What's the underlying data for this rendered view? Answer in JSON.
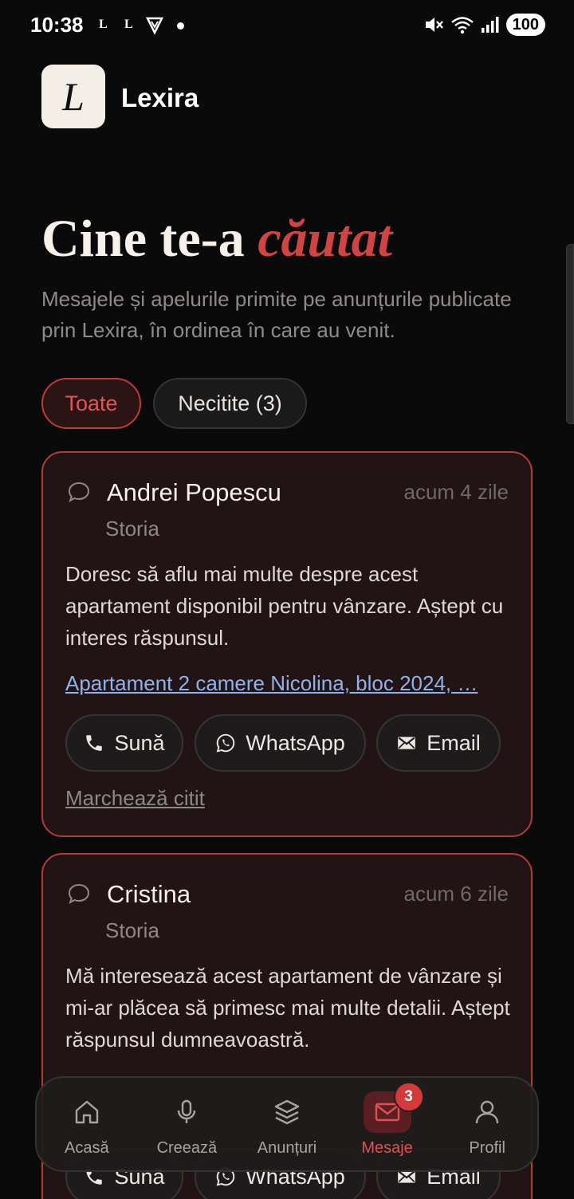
{
  "status_bar": {
    "time": "10:38",
    "notif1": "L",
    "notif2": "L",
    "battery": "100"
  },
  "header": {
    "logo_letter": "L",
    "app_name": "Lexira"
  },
  "page": {
    "title_main": "Cine te-a ",
    "title_accent": "căutat",
    "subtitle": "Mesajele și apelurile primite pe anunțurile publicate prin Lexira, în ordinea în care au venit."
  },
  "filters": {
    "all": "Toate",
    "unread": "Necitite (3)"
  },
  "messages": [
    {
      "sender": "Andrei Popescu",
      "time": "acum 4 zile",
      "source": "Storia",
      "body": "Doresc să aflu mai multe despre acest apartament disponibil pentru vânzare. Aștept cu interes răspunsul.",
      "listing": "Apartament 2 camere Nicolina, bloc 2024, …",
      "call": "Sună",
      "whatsapp": "WhatsApp",
      "email": "Email",
      "mark_read": "Marchează citit"
    },
    {
      "sender": "Cristina",
      "time": "acum 6 zile",
      "source": "Storia",
      "body": "Mă interesează acest apartament de vânzare și mi-ar plăcea să primesc mai multe detalii. Aștept răspunsul dumneavoastră.",
      "call": "Sună",
      "whatsapp": "WhatsApp",
      "email": "Email"
    }
  ],
  "nav": {
    "home": "Acasă",
    "create": "Creează",
    "listings": "Anunțuri",
    "messages": "Mesaje",
    "messages_badge": "3",
    "profile": "Profil"
  },
  "colors": {
    "accent": "#d04444",
    "card_bg": "#221314",
    "card_border": "#b23a3e",
    "link": "#8fb2ea"
  }
}
